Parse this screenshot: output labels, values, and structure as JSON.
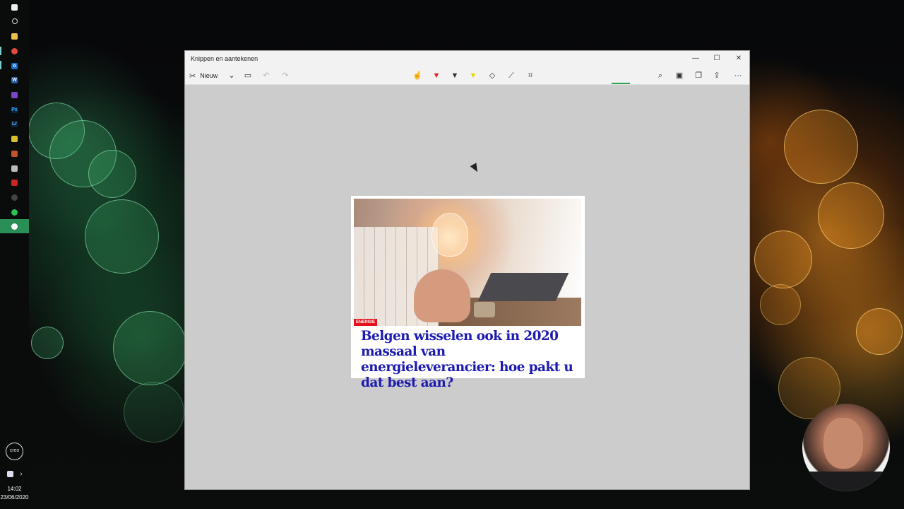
{
  "window": {
    "title": "Knippen en aantekenen",
    "controls": {
      "minimize": "—",
      "maximize": "☐",
      "close": "✕"
    }
  },
  "toolbar": {
    "new_label": "Nieuw",
    "new_dropdown_icon": "chevron-down-icon",
    "left_tools": [
      "snip-mode-icon",
      "undo-icon",
      "redo-icon"
    ],
    "center_tools": [
      "touch-writing-icon",
      "ballpoint-pen-icon",
      "pencil-icon",
      "highlighter-icon",
      "eraser-icon",
      "ruler-icon",
      "crop-icon"
    ],
    "right_tools": [
      "zoom-icon",
      "save-icon",
      "copy-icon",
      "share-icon",
      "more-icon"
    ],
    "more_label": "···",
    "selected_tool_color": "#2da44e"
  },
  "snip": {
    "badge": "ENERGIE",
    "headline": "Belgen wisselen ook in 2020 massaal van energieleverancier: hoe pakt u dat best aan?",
    "headline_color": "#1c1ab0",
    "badge_color": "#e3121b"
  },
  "taskbar": {
    "time": "14:02",
    "date": "23/06/2020",
    "apps": [
      "windows-start-icon",
      "search-icon",
      "file-explorer-icon",
      "chrome-icon",
      "outlook-icon",
      "word-icon",
      "visual-studio-icon",
      "photoshop-icon",
      "lightroom-icon",
      "python-icon",
      "app-icon",
      "notepad-icon",
      "mail-icon",
      "media-icon",
      "whatsapp-icon",
      "snip-sketch-icon"
    ],
    "creo_label": "creo",
    "tray": [
      "dropbox-icon",
      "chevron-right-icon"
    ]
  }
}
